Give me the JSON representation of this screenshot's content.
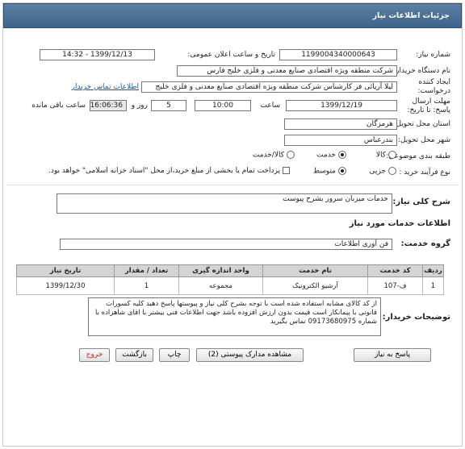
{
  "header": {
    "title": "جزئیات اطلاعات نیاز"
  },
  "form": {
    "need_number_label": "شماره نیاز:",
    "need_number": "1199004340000643",
    "announce_datetime_label": "تاریخ و ساعت اعلان عمومی:",
    "announce_datetime": "1399/12/13 - 14:32",
    "buyer_org_label": "نام دستگاه خریدار:",
    "buyer_org": "شرکت منطقه ویژه اقتصادی صنایع معدنی و فلزی خلیج فارس",
    "requester_label": "ایجاد کننده درخواست:",
    "requester": "لیلا آریائی فر کارشناس شرکت منطقه ویژه اقتصادی صنایع معدنی و فلزی خلیج",
    "contact_link": "اطلاعات تماس خریدار",
    "deadline_label": "مهلت ارسال پاسخ: تا تاریخ:",
    "deadline_date": "1399/12/19",
    "time_label": "ساعت",
    "deadline_time": "10:00",
    "days_value": "5",
    "days_label": "روز و",
    "remaining_time": "16:06:36",
    "remaining_label": "ساعت باقی مانده",
    "province_label": "استان محل تحویل:",
    "province": "هرمزگان",
    "city_label": "شهر محل تحویل:",
    "city": "بندرعباس",
    "category_label": "طبقه بندی موضوعی:",
    "category_options": [
      "کالا",
      "خدمت",
      "کالا/خدمت"
    ],
    "category_selected": "خدمت",
    "process_label": "نوع فرآیند خرید :",
    "process_options": [
      "جزیی",
      "متوسط"
    ],
    "process_selected": "متوسط",
    "treasury_note": "پرداخت تمام یا بخشی از مبلغ خرید،از محل \"اسناد خزانه اسلامی\" خواهد بود."
  },
  "summary": {
    "label": "شرح کلی نیاز:",
    "value": "خدمات میزبان سرور بشرح پیوست"
  },
  "services_section": {
    "title": "اطلاعات خدمات مورد نیاز"
  },
  "service_group": {
    "label": "گروه خدمت:",
    "value": "فن آوری اطلاعات"
  },
  "table": {
    "headers": [
      "ردیف",
      "کد خدمت",
      "نام خدمت",
      "واحد اندازه گیری",
      "تعداد / مقدار",
      "تاریخ نیاز"
    ],
    "rows": [
      [
        "1",
        "ف-107",
        "آرشیو الکترونیک",
        "مجموعه",
        "1",
        "1399/12/30"
      ]
    ]
  },
  "description": {
    "label": "توضیحات خریدار:",
    "text": "از کد کالای مشابه استفاده شده است با توجه بشرح کلی نیاز و پیوستها پاسخ دهید کلیه کسورات قانونی با پیمانکار است قیمت بدون ارزش افزوده باشد جهت اطلاعات فنی بیشتر با اقای شاهزاده با شماره 09173680975 تماس بگیرید"
  },
  "buttons": {
    "reply": "پاسخ به نیاز",
    "attachments": "مشاهده مدارک پیوستی (2)",
    "print": "چاپ",
    "back": "بازگشت",
    "exit": "خروج"
  }
}
